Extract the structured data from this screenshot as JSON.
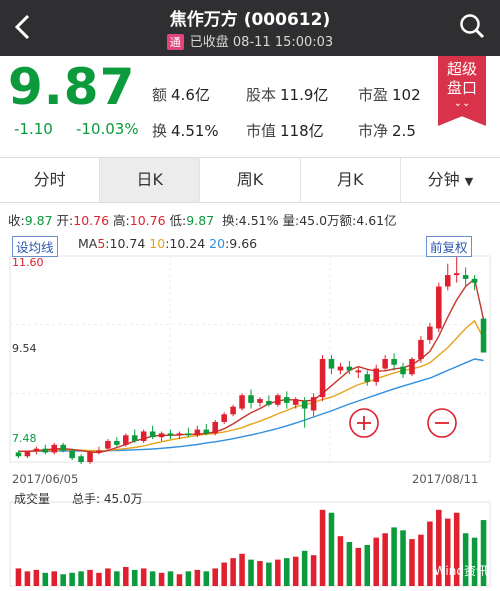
{
  "header": {
    "title": "焦作万方 (000612)",
    "tag": "通",
    "status": "已收盘 08-11 15:00:03"
  },
  "quote": {
    "price": "9.87",
    "change": "-1.10",
    "change_pct": "-10.03%",
    "amount_label": "额",
    "amount": "4.6亿",
    "capital_label": "股本",
    "capital": "11.9亿",
    "pe_label": "市盈",
    "pe": "102",
    "turnover_label": "换",
    "turnover": "4.51%",
    "mktcap_label": "市值",
    "mktcap": "118亿",
    "pb_label": "市净",
    "pb": "2.5"
  },
  "ribbon": {
    "line1": "超级",
    "line2": "盘口",
    "chev": "⌄⌄"
  },
  "tabs": [
    "分时",
    "日K",
    "周K",
    "月K",
    "分钟"
  ],
  "ohlc": {
    "close_label": "收:",
    "close": "9.87",
    "open_label": "开:",
    "open": "10.76",
    "high_label": "高:",
    "high": "10.76",
    "low_label": "低:",
    "low": "9.87",
    "turn_label": "换:",
    "turn": "4.51%",
    "vol_label": "量:",
    "vol": "45.0万",
    "amt_label": "额:",
    "amt": "4.61亿"
  },
  "chart": {
    "set_ma_button": "设均线",
    "ma_prefix": "MA",
    "ma5_key": "5",
    "ma5_val": ":10.74",
    "ma10_key": "10",
    "ma10_val": ":10.24",
    "ma20_key": "20",
    "ma20_val": ":9.66",
    "adjust_button": "前复权",
    "y_top": "11.60",
    "y_mid": "9.54",
    "y_low": "7.48",
    "date_start": "2017/06/05",
    "date_end": "2017/08/11",
    "volume_label": "成交量",
    "total_label": "总手:",
    "total_value": "45.0万",
    "watermark": "Wind资讯",
    "colors": {
      "up": "#e0202e",
      "down": "#0b9a3c",
      "ma5": "#c8342b",
      "ma10": "#e8a21a",
      "ma20": "#2f8fe0"
    }
  },
  "chart_data": {
    "type": "candlestick",
    "x_range": [
      "2017/06/05",
      "2017/08/11"
    ],
    "ylim": [
      7.0,
      12.4
    ],
    "y_ticks": [
      11.6,
      9.54,
      7.48
    ],
    "candles": [
      [
        7.25,
        7.3,
        7.15,
        7.1
      ],
      [
        7.15,
        7.3,
        7.3,
        7.1
      ],
      [
        7.3,
        7.4,
        7.35,
        7.2
      ],
      [
        7.35,
        7.45,
        7.25,
        7.2
      ],
      [
        7.25,
        7.5,
        7.45,
        7.2
      ],
      [
        7.45,
        7.5,
        7.3,
        7.25
      ],
      [
        7.3,
        7.35,
        7.1,
        7.05
      ],
      [
        7.15,
        7.2,
        7.0,
        6.95
      ],
      [
        7.0,
        7.3,
        7.25,
        6.95
      ],
      [
        7.25,
        7.4,
        7.3,
        7.2
      ],
      [
        7.35,
        7.6,
        7.55,
        7.3
      ],
      [
        7.55,
        7.65,
        7.45,
        7.4
      ],
      [
        7.45,
        7.75,
        7.7,
        7.4
      ],
      [
        7.7,
        7.85,
        7.55,
        7.5
      ],
      [
        7.55,
        7.85,
        7.8,
        7.5
      ],
      [
        7.8,
        7.95,
        7.65,
        7.6
      ],
      [
        7.65,
        7.8,
        7.75,
        7.55
      ],
      [
        7.75,
        7.85,
        7.7,
        7.6
      ],
      [
        7.7,
        7.8,
        7.75,
        7.6
      ],
      [
        7.75,
        7.9,
        7.7,
        7.65
      ],
      [
        7.7,
        7.95,
        7.85,
        7.65
      ],
      [
        7.85,
        8.0,
        7.75,
        7.7
      ],
      [
        7.75,
        8.1,
        8.05,
        7.7
      ],
      [
        8.05,
        8.3,
        8.25,
        8.0
      ],
      [
        8.25,
        8.5,
        8.45,
        8.2
      ],
      [
        8.4,
        8.8,
        8.75,
        8.35
      ],
      [
        8.75,
        8.9,
        8.55,
        8.4
      ],
      [
        8.55,
        8.7,
        8.65,
        8.45
      ],
      [
        8.6,
        8.75,
        8.5,
        8.45
      ],
      [
        8.5,
        8.8,
        8.75,
        8.45
      ],
      [
        8.7,
        8.85,
        8.55,
        8.4
      ],
      [
        8.5,
        8.7,
        8.65,
        8.4
      ],
      [
        8.6,
        8.7,
        8.4,
        7.9
      ],
      [
        8.35,
        8.8,
        8.7,
        8.2
      ],
      [
        8.7,
        9.8,
        9.7,
        8.6
      ],
      [
        9.7,
        9.8,
        9.45,
        9.3
      ],
      [
        9.4,
        9.6,
        9.5,
        9.3
      ],
      [
        9.5,
        9.65,
        9.4,
        9.3
      ],
      [
        9.35,
        9.5,
        9.4,
        9.2
      ],
      [
        9.3,
        9.4,
        9.1,
        9.0
      ],
      [
        9.1,
        9.55,
        9.45,
        9.0
      ],
      [
        9.45,
        9.8,
        9.7,
        9.4
      ],
      [
        9.7,
        9.85,
        9.55,
        9.4
      ],
      [
        9.5,
        9.6,
        9.3,
        9.2
      ],
      [
        9.3,
        9.75,
        9.7,
        9.25
      ],
      [
        9.7,
        10.3,
        10.2,
        9.6
      ],
      [
        10.2,
        10.65,
        10.55,
        10.1
      ],
      [
        10.5,
        11.7,
        11.6,
        10.4
      ],
      [
        11.6,
        12.2,
        11.9,
        11.5
      ],
      [
        11.9,
        12.4,
        11.95,
        11.7
      ],
      [
        11.9,
        12.1,
        11.8,
        11.6
      ],
      [
        11.8,
        11.9,
        11.7,
        11.5
      ],
      [
        10.76,
        10.76,
        9.87,
        9.87
      ]
    ],
    "candle_fields": [
      "open",
      "high",
      "close",
      "low"
    ],
    "ma": [
      {
        "name": "MA5",
        "values": [
          7.28,
          7.28,
          7.3,
          7.32,
          7.34,
          7.35,
          7.33,
          7.3,
          7.26,
          7.25,
          7.3,
          7.38,
          7.46,
          7.55,
          7.61,
          7.68,
          7.7,
          7.7,
          7.71,
          7.73,
          7.73,
          7.75,
          7.79,
          7.87,
          8.0,
          8.15,
          8.29,
          8.4,
          8.53,
          8.6,
          8.64,
          8.62,
          8.6,
          8.62,
          8.8,
          9.0,
          9.2,
          9.4,
          9.5,
          9.43,
          9.38,
          9.39,
          9.44,
          9.47,
          9.55,
          9.7,
          9.9,
          10.3,
          10.8,
          11.25,
          11.6,
          11.8,
          10.74
        ]
      },
      {
        "name": "MA10",
        "values": [
          7.28,
          7.28,
          7.29,
          7.3,
          7.31,
          7.32,
          7.32,
          7.31,
          7.3,
          7.29,
          7.3,
          7.33,
          7.35,
          7.38,
          7.42,
          7.48,
          7.53,
          7.58,
          7.62,
          7.66,
          7.7,
          7.73,
          7.75,
          7.79,
          7.84,
          7.9,
          7.99,
          8.07,
          8.16,
          8.26,
          8.35,
          8.45,
          8.5,
          8.56,
          8.64,
          8.7,
          8.8,
          8.92,
          9.03,
          9.1,
          9.18,
          9.26,
          9.33,
          9.4,
          9.44,
          9.5,
          9.6,
          9.8,
          10.0,
          10.25,
          10.5,
          10.7,
          10.24
        ]
      },
      {
        "name": "MA20",
        "values": [
          7.28,
          7.28,
          7.28,
          7.28,
          7.29,
          7.29,
          7.29,
          7.29,
          7.29,
          7.29,
          7.3,
          7.3,
          7.31,
          7.32,
          7.33,
          7.34,
          7.36,
          7.38,
          7.4,
          7.43,
          7.46,
          7.5,
          7.53,
          7.57,
          7.61,
          7.66,
          7.71,
          7.76,
          7.82,
          7.88,
          7.95,
          8.02,
          8.1,
          8.18,
          8.26,
          8.34,
          8.43,
          8.52,
          8.6,
          8.68,
          8.76,
          8.84,
          8.92,
          8.99,
          9.06,
          9.13,
          9.2,
          9.3,
          9.4,
          9.5,
          9.6,
          9.7,
          9.66
        ]
      }
    ],
    "volume": [
      1.2,
      1.0,
      1.1,
      0.9,
      1.0,
      0.8,
      0.9,
      1.0,
      1.1,
      0.9,
      1.2,
      1.0,
      1.3,
      1.1,
      1.2,
      1.0,
      0.9,
      1.0,
      0.8,
      1.0,
      1.1,
      1.0,
      1.2,
      1.6,
      1.9,
      2.2,
      1.8,
      1.7,
      1.6,
      1.8,
      1.9,
      2.0,
      2.4,
      2.1,
      5.2,
      5.0,
      3.4,
      3.0,
      2.6,
      2.8,
      3.3,
      3.6,
      4.0,
      3.8,
      3.2,
      3.5,
      4.4,
      5.2,
      4.6,
      5.0,
      3.6,
      3.3,
      4.5
    ],
    "volume_up": [
      true,
      true,
      true,
      false,
      true,
      false,
      false,
      false,
      true,
      true,
      true,
      false,
      true,
      false,
      true,
      false,
      true,
      false,
      true,
      false,
      true,
      false,
      true,
      true,
      true,
      true,
      false,
      true,
      false,
      true,
      false,
      true,
      false,
      true,
      true,
      false,
      true,
      false,
      true,
      false,
      true,
      true,
      false,
      false,
      true,
      true,
      true,
      true,
      true,
      true,
      false,
      false,
      false
    ]
  }
}
